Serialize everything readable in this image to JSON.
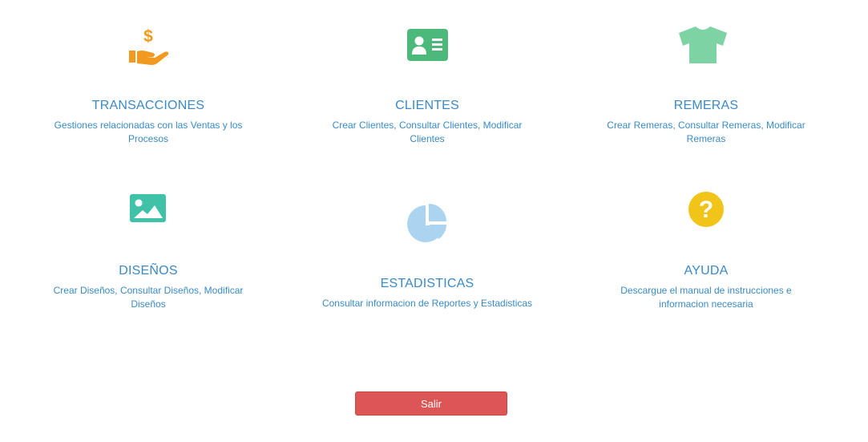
{
  "tiles": [
    {
      "title": "TRANSACCIONES",
      "description": "Gestiones relacionadas con las Ventas y los Procesos",
      "icon": "hand-dollar-icon",
      "color": "#f29a1f"
    },
    {
      "title": "CLIENTES",
      "description": "Crear Clientes, Consultar Clientes, Modificar Clientes",
      "icon": "id-card-icon",
      "color": "#4cb87a"
    },
    {
      "title": "REMERAS",
      "description": "Crear Remeras, Consultar Remeras, Modificar Remeras",
      "icon": "tshirt-icon",
      "color": "#7dd3a4"
    },
    {
      "title": "DISEÑOS",
      "description": "Crear Diseños, Consultar Diseños, Modificar Diseños",
      "icon": "image-icon",
      "color": "#3fc2a8"
    },
    {
      "title": "ESTADISTICAS",
      "description": "Consultar informacion de Reportes y Estadisticas",
      "icon": "pie-chart-icon",
      "color": "#aad4f0"
    },
    {
      "title": "AYUDA",
      "description": "Descargue el manual de instrucciones e informacion necesaria",
      "icon": "question-circle-icon",
      "color": "#f0c419"
    }
  ],
  "exit_button": {
    "label": "Salir",
    "color": "#dd5656"
  }
}
